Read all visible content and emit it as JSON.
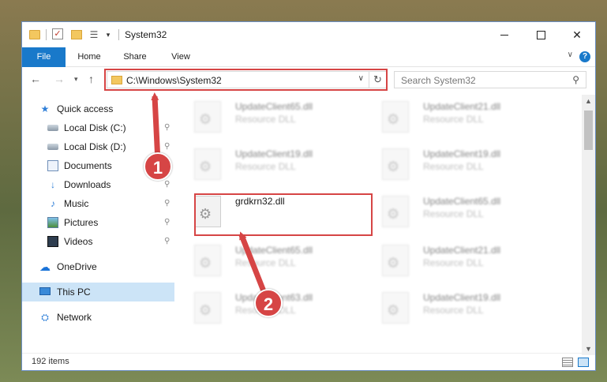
{
  "window": {
    "title": "System32",
    "qa_check": "✓",
    "qa_props": "☰",
    "qa_down": "▾",
    "controls": {
      "close": "✕"
    }
  },
  "ribbon": {
    "tabs": [
      {
        "label": "File"
      },
      {
        "label": "Home"
      },
      {
        "label": "Share"
      },
      {
        "label": "View"
      }
    ],
    "expand": "∨",
    "help": "?"
  },
  "nav": {
    "back": "←",
    "forward": "→",
    "recent": "▾",
    "up": "↑",
    "address": "C:\\Windows\\System32",
    "address_drop": "∨",
    "refresh": "↻",
    "search_placeholder": "Search System32",
    "search_icon": "⚲"
  },
  "sidebar": {
    "items": [
      {
        "label": "Quick access",
        "icon": "★"
      },
      {
        "label": "Local Disk (C:)",
        "icon": ""
      },
      {
        "label": "Local Disk (D:)",
        "icon": ""
      },
      {
        "label": "Documents",
        "icon": ""
      },
      {
        "label": "Downloads",
        "icon": "↓"
      },
      {
        "label": "Music",
        "icon": "♪"
      },
      {
        "label": "Pictures",
        "icon": ""
      },
      {
        "label": "Videos",
        "icon": ""
      },
      {
        "label": "OneDrive",
        "icon": "☁"
      },
      {
        "label": "This PC",
        "icon": ""
      },
      {
        "label": "Network",
        "icon": "⛭"
      }
    ],
    "pin": "⚲"
  },
  "files": {
    "gear": "⚙",
    "type": "Resource DLL",
    "items": [
      {
        "name": "UpdateClient65.dll"
      },
      {
        "name": "UpdateClient21.dll"
      },
      {
        "name": "UpdateClient19.dll"
      },
      {
        "name": "UpdateClient19.dll"
      },
      {
        "name": "grdkrn32.dll"
      },
      {
        "name": "UpdateClient65.dll"
      },
      {
        "name": "UpdateClient65.dll"
      },
      {
        "name": "UpdateClient21.dll"
      },
      {
        "name": "UpdateClient63.dll"
      },
      {
        "name": "UpdateClient19.dll"
      }
    ]
  },
  "scroll": {
    "up": "▲",
    "down": "▼"
  },
  "status": {
    "count": "192 items"
  },
  "callouts": {
    "one": "1",
    "two": "2"
  },
  "colors": {
    "accent": "#1979ca",
    "highlight": "#d64545",
    "selected": "#cce4f7"
  }
}
